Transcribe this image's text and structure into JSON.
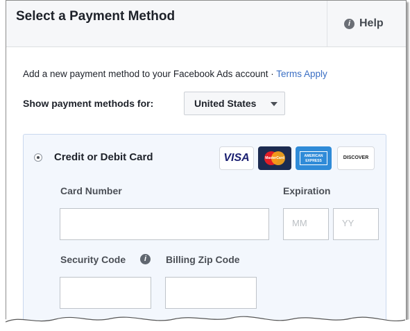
{
  "header": {
    "title": "Select a Payment Method",
    "help_label": "Help",
    "help_icon": "info-circle-icon"
  },
  "intro": {
    "text": "Add a new payment method to your Facebook Ads account · ",
    "terms_link": "Terms Apply"
  },
  "country_selector": {
    "label": "Show payment methods for:",
    "selected": "United States"
  },
  "payment_method": {
    "label": "Credit or Debit Card",
    "selected": true,
    "card_logos": {
      "visa": "VISA",
      "mastercard": "MasterCard",
      "amex": "AMERICAN EXPRESS",
      "discover": "DISCOVER"
    }
  },
  "form": {
    "card_number_label": "Card Number",
    "expiration_label": "Expiration",
    "month_placeholder": "MM",
    "year_placeholder": "YY",
    "security_code_label": "Security Code",
    "billing_zip_label": "Billing Zip Code"
  },
  "colors": {
    "link": "#3b6fc4",
    "panel_border": "#c9d8ee",
    "panel_background": "#f3f7fd"
  }
}
